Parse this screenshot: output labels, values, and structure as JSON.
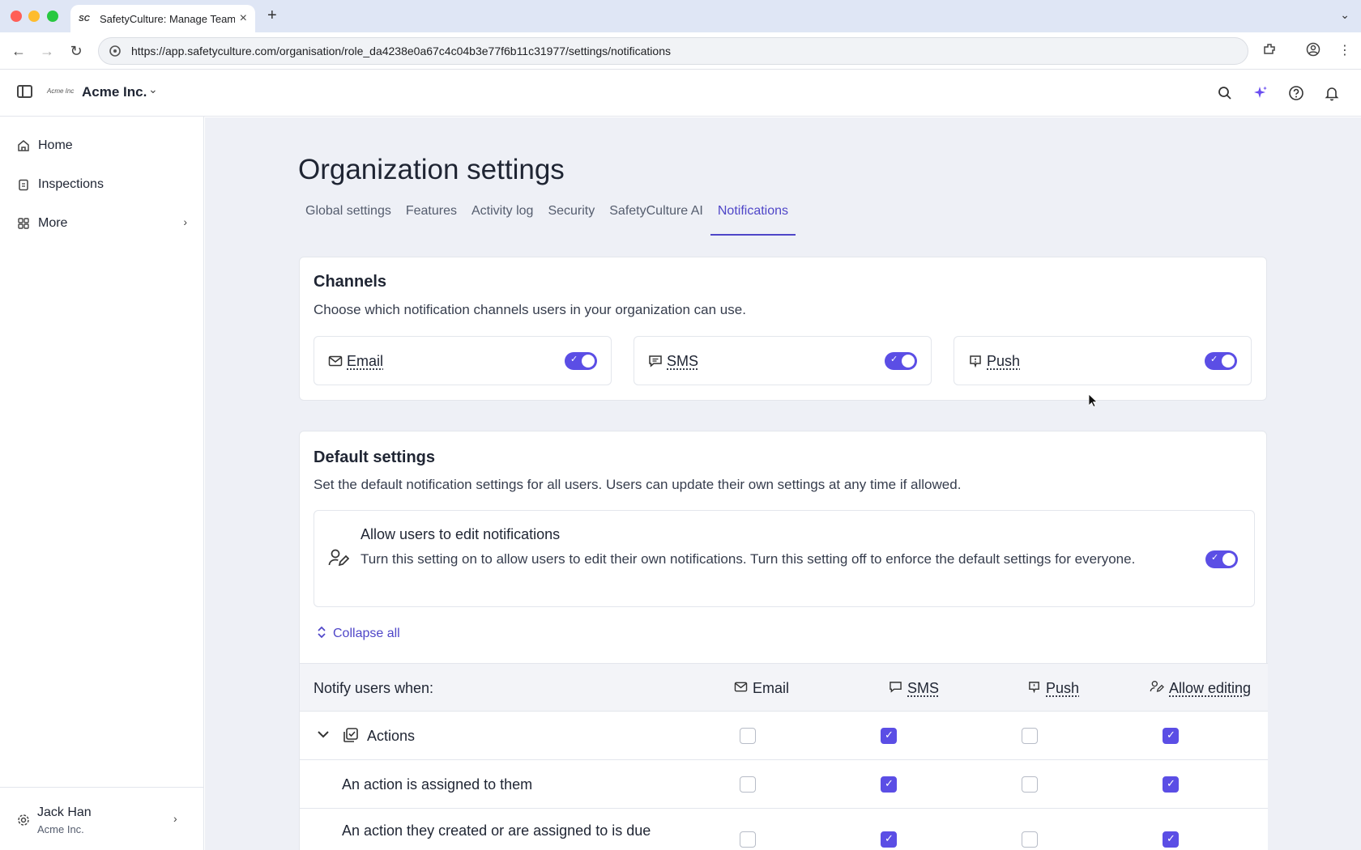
{
  "browser": {
    "tab_title": "SafetyCulture: Manage Teams",
    "favicon": "SC",
    "url": "https://app.safetyculture.com/organisation/role_da4238e0a67c4c04b3e77f6b11c31977/settings/notifications"
  },
  "header": {
    "org_logo": "Acme Inc",
    "org_name": "Acme Inc."
  },
  "sidebar": {
    "items": [
      {
        "label": "Home",
        "icon": "home-icon"
      },
      {
        "label": "Inspections",
        "icon": "clipboard-icon"
      },
      {
        "label": "More",
        "icon": "grid-icon"
      }
    ],
    "user": {
      "name": "Jack Han",
      "org": "Acme Inc."
    }
  },
  "page": {
    "title": "Organization settings",
    "tabs": [
      {
        "label": "Global settings",
        "active": false
      },
      {
        "label": "Features",
        "active": false
      },
      {
        "label": "Activity log",
        "active": false
      },
      {
        "label": "Security",
        "active": false
      },
      {
        "label": "SafetyCulture AI",
        "active": false
      },
      {
        "label": "Notifications",
        "active": true
      }
    ]
  },
  "channels": {
    "title": "Channels",
    "description": "Choose which notification channels users in your organization can use.",
    "items": [
      {
        "label": "Email",
        "enabled": true,
        "icon": "mail-icon"
      },
      {
        "label": "SMS",
        "enabled": true,
        "icon": "message-icon"
      },
      {
        "label": "Push",
        "enabled": true,
        "icon": "push-icon"
      }
    ]
  },
  "defaults": {
    "title": "Default settings",
    "description": "Set the default notification settings for all users. Users can update their own settings at any time if allowed.",
    "allow_edit": {
      "title": "Allow users to edit notifications",
      "description": "Turn this setting on to allow users to edit their own notifications. Turn this setting off to enforce the default settings for everyone.",
      "enabled": true
    },
    "collapse_label": "Collapse all"
  },
  "table": {
    "header_label": "Notify users when:",
    "columns": [
      "Email",
      "SMS",
      "Push",
      "Allow editing"
    ],
    "rows": [
      {
        "label": "Actions",
        "group": true,
        "values": [
          false,
          true,
          false,
          true
        ]
      },
      {
        "label": "An action is assigned to them",
        "group": false,
        "values": [
          false,
          true,
          false,
          true
        ]
      },
      {
        "label": "An action they created or are assigned to is due",
        "group": false,
        "values": [
          false,
          true,
          false,
          true
        ]
      }
    ]
  },
  "colors": {
    "accent": "#5b4ee5",
    "tab_active": "#4f46c8",
    "background": "#eef0f6"
  }
}
